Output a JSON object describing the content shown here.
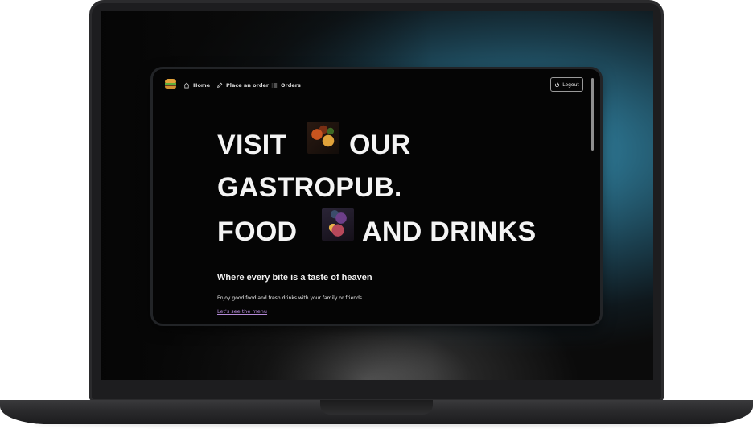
{
  "nav": {
    "logo_icon": "burger-icon",
    "home_label": "Home",
    "place_order_label": "Place an order",
    "orders_label": "Orders",
    "logout_label": "Logout"
  },
  "hero": {
    "line1_a": "VISIT",
    "line1_b": "OUR",
    "line2": "GASTROPUB.",
    "line3_a": "FOOD",
    "line3_b": "AND DRINKS",
    "tagline": "Where every bite is a taste of heaven",
    "description": "Enjoy good food and fresh drinks with your family or friends",
    "menu_link": "Let's see the menu"
  },
  "colors": {
    "app_background": "#050505",
    "link_color": "#b58ad8",
    "text_color": "#f4f4f4"
  }
}
